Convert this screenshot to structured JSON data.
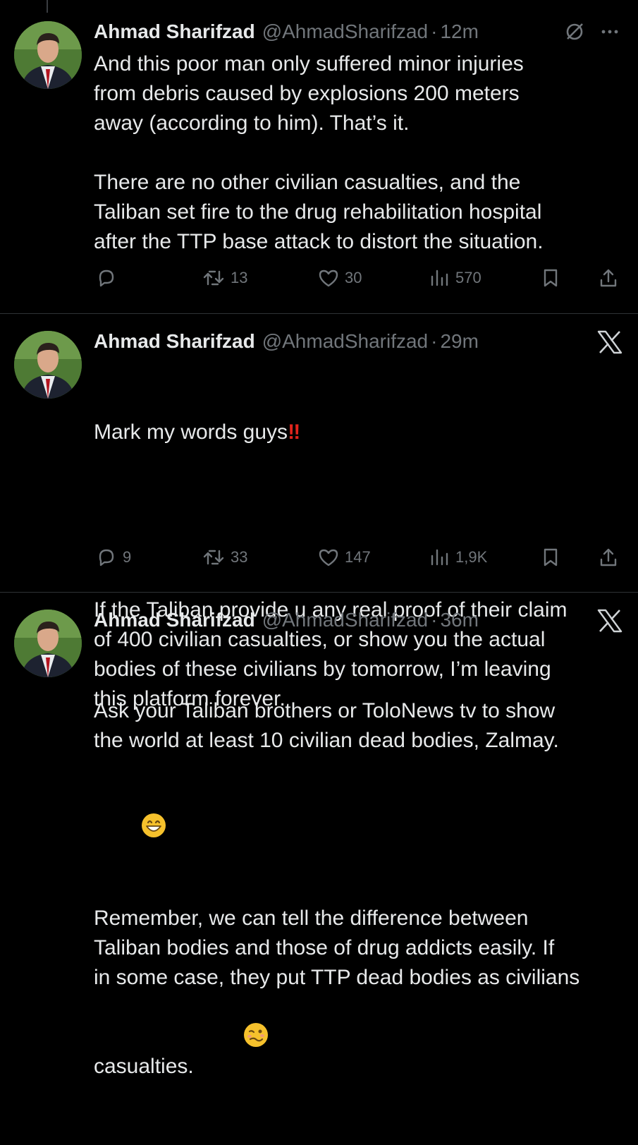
{
  "colors": {
    "background": "#000000",
    "text": "#e7e9ea",
    "muted": "#71767b",
    "divider": "#2f3336",
    "accent_red": "#e0241c"
  },
  "tweets": [
    {
      "name": "Ahmad Sharifzad",
      "handle": "@AhmadSharifzad",
      "sep": "·",
      "time": "12m",
      "top_icons": [
        "grok-icon",
        "more-icon"
      ],
      "text": "And this poor man only suffered minor injuries\nfrom debris caused by explosions 200 meters\naway (according to him). That’s it.\n\nThere are no other civilian casualties, and the\nTaliban set fire to the drug rehabilitation hospital\nafter the TTP base attack to distort the situation.",
      "replies": "",
      "reposts": "13",
      "likes": "30",
      "views": "570"
    },
    {
      "name": "Ahmad Sharifzad",
      "handle": "@AhmadSharifzad",
      "sep": "·",
      "time": "29m",
      "top_icons": [
        "x-logo-icon"
      ],
      "text_line1": "Mark my words guys",
      "emoji_bang": "‼",
      "text": "If the Taliban provide u any real proof of their claim\nof 400 civilian casualties, or show you the actual\nbodies of these civilians by tomorrow, I’m leaving\nthis platform forever.",
      "replies": "9",
      "reposts": "33",
      "likes": "147",
      "views": "1,9K"
    },
    {
      "name": "Ahmad Sharifzad",
      "handle": "@AhmadSharifzad",
      "sep": "·",
      "time": "36m",
      "top_icons": [
        "x-logo-icon"
      ],
      "text_part1": "Ask your Taliban brothers or ToloNews tv to show\nthe world at least 10 civilian dead bodies, Zalmay.",
      "text_part2": "Remember, we can tell the difference between\nTaliban bodies and those of drug addicts easily. If\nin some case, they put TTP dead bodies as civilians\ncasualties."
    }
  ]
}
